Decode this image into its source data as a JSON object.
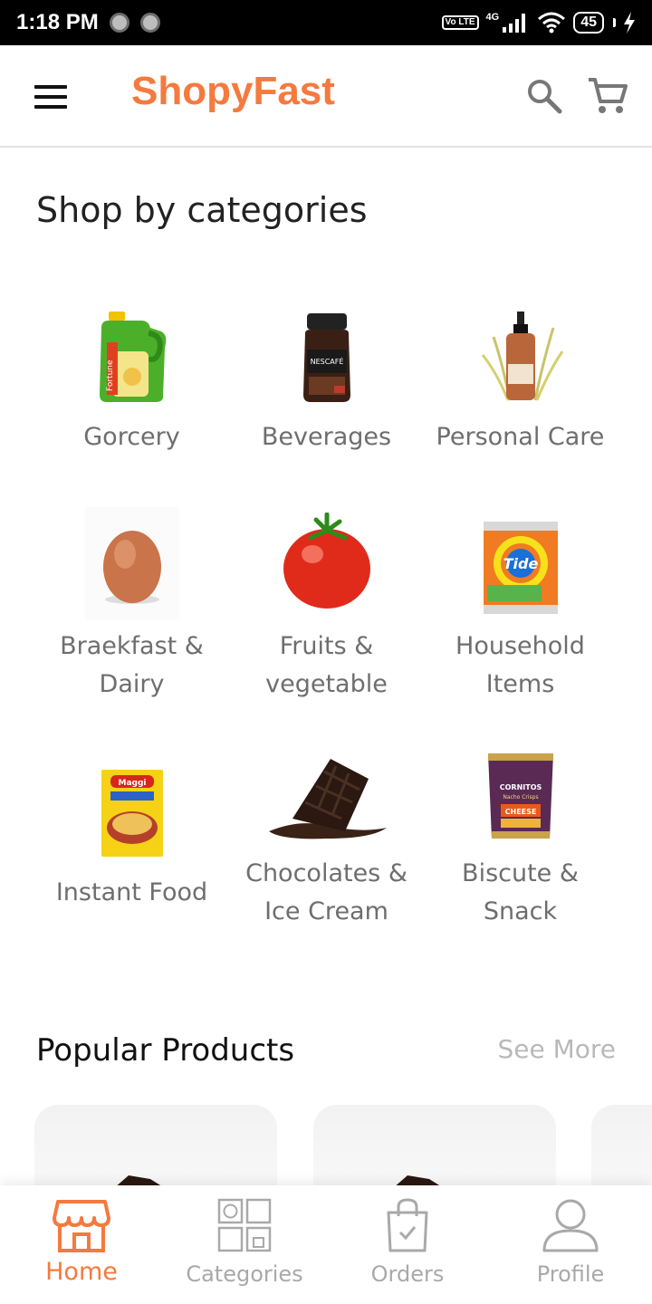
{
  "status_bar": {
    "time": "1:18 PM",
    "volte": "Vo LTE",
    "network": "4G",
    "battery": "45"
  },
  "app_bar": {
    "brand": "ShopyFast",
    "icons": [
      "menu-icon",
      "search-icon",
      "cart-icon"
    ]
  },
  "categories": {
    "title": "Shop by categories",
    "items": [
      {
        "label_line1": "Gorcery",
        "label_line2": ""
      },
      {
        "label_line1": "Beverages",
        "label_line2": ""
      },
      {
        "label_line1": "Personal Care",
        "label_line2": ""
      },
      {
        "label_line1": "Braekfast &",
        "label_line2": "Dairy"
      },
      {
        "label_line1": "Fruits &",
        "label_line2": "vegetable"
      },
      {
        "label_line1": "Household",
        "label_line2": "Items"
      },
      {
        "label_line1": "Instant Food",
        "label_line2": ""
      },
      {
        "label_line1": "Chocolates &",
        "label_line2": "Ice Cream"
      },
      {
        "label_line1": "Biscute &",
        "label_line2": "Snack"
      }
    ]
  },
  "product_images": {
    "tide_text": "Tide",
    "maggi_text": "Maggi",
    "cornitos_text": "CORNITOS",
    "cornitos_sub": "Nacho Crisps",
    "cheese_text": "CHEESE",
    "nescafe_text": "NESCAFÉ",
    "fortune_text": "Fortune"
  },
  "popular": {
    "title": "Popular Products",
    "see_more": "See More"
  },
  "bottom_nav": {
    "items": [
      {
        "label": "Home",
        "active": true
      },
      {
        "label": "Categories",
        "active": false
      },
      {
        "label": "Orders",
        "active": false
      },
      {
        "label": "Profile",
        "active": false
      }
    ]
  },
  "colors": {
    "accent": "#f47a3e",
    "inactive": "#a9a9a9",
    "label": "#6e6e6e"
  }
}
